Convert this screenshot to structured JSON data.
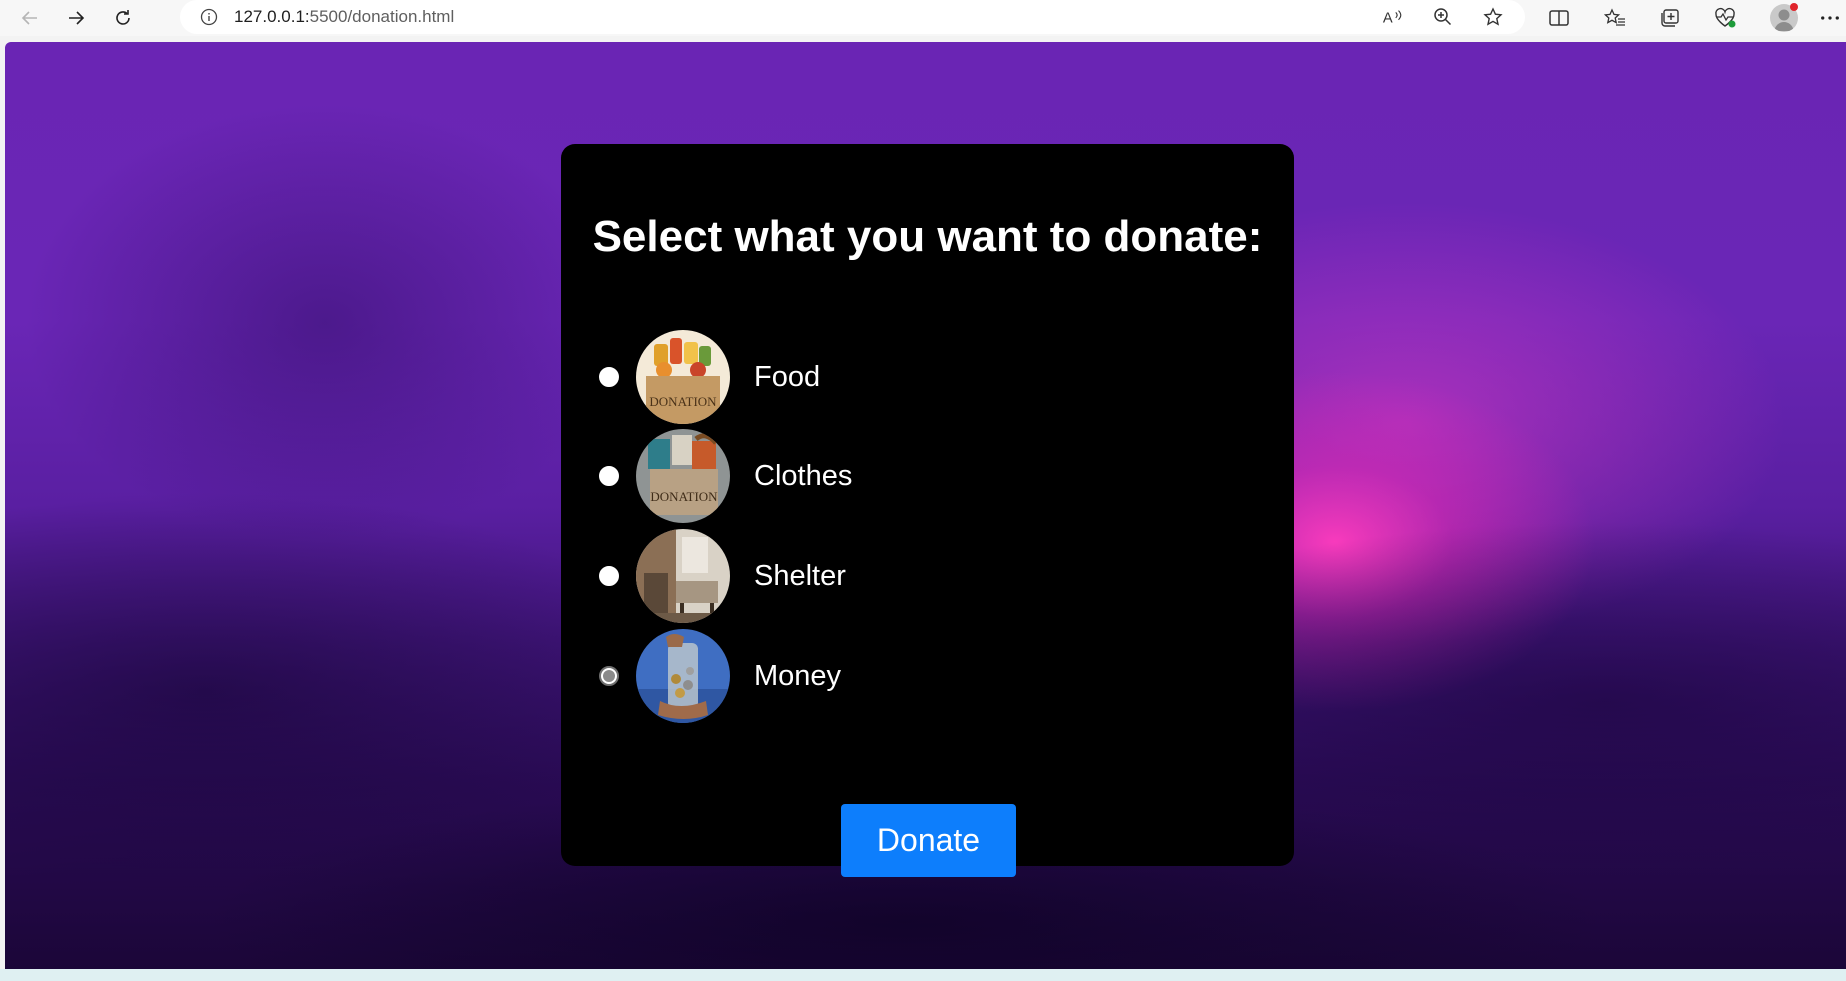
{
  "browser": {
    "url_host": "127.0.0.1:",
    "url_rest": "5500/donation.html",
    "icons": {
      "back": "back-arrow-icon",
      "forward": "forward-arrow-icon",
      "reload": "reload-icon",
      "site_info": "info-icon",
      "read_aloud": "read-aloud-icon",
      "zoom": "zoom-icon",
      "favorite": "star-icon",
      "split_screen": "split-screen-icon",
      "favorites_list": "favorites-icon",
      "collections": "collections-icon",
      "performance": "heartbeat-icon",
      "profile": "profile-avatar-icon",
      "more": "more-icon"
    }
  },
  "donation": {
    "title": "Select what you want to donate:",
    "options": [
      {
        "label": "Food",
        "checked": false,
        "image_text": "DONATION"
      },
      {
        "label": "Clothes",
        "checked": false,
        "image_text": "DONATION"
      },
      {
        "label": "Shelter",
        "checked": false
      },
      {
        "label": "Money",
        "checked": true
      }
    ],
    "button_label": "Donate"
  },
  "colors": {
    "card_background": "#000000",
    "button": "#0d7efc",
    "page_background_top": "#6a25b4",
    "glow": "#ff3cbe"
  }
}
